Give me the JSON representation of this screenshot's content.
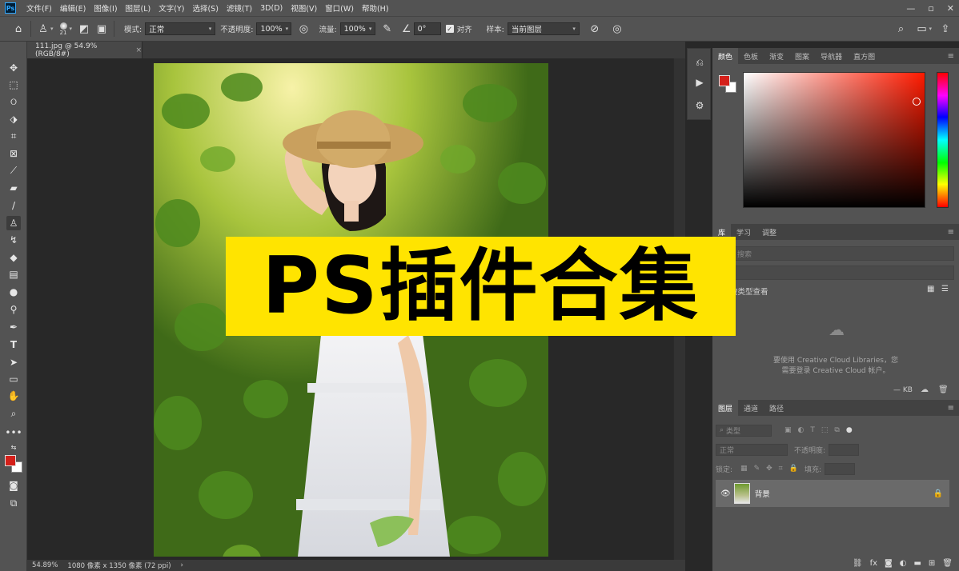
{
  "menubar": {
    "logo": "Ps",
    "items": [
      "文件(F)",
      "编辑(E)",
      "图像(I)",
      "图层(L)",
      "文字(Y)",
      "选择(S)",
      "滤镜(T)",
      "3D(D)",
      "视图(V)",
      "窗口(W)",
      "帮助(H)"
    ],
    "controls": [
      "—",
      "▫",
      "✕"
    ]
  },
  "options": {
    "brush_size": "21",
    "mode_label": "模式:",
    "mode_value": "正常",
    "opacity_label": "不透明度:",
    "opacity_value": "100%",
    "flow_label": "流量:",
    "flow_value": "100%",
    "angle_value": "0°",
    "align_label": "对齐",
    "sample_label": "样本:",
    "sample_value": "当前图层"
  },
  "document": {
    "tab_label": "111.jpg @ 54.9%(RGB/8#)",
    "tab_close": "×",
    "zoom": "54.89%",
    "dims": "1080 像素 x 1350 像素 (72 ppi)",
    "status_arrow": "›"
  },
  "banner": {
    "text": "PS插件合集",
    "color": "#ffe400"
  },
  "color_panel": {
    "tabs": [
      "颜色",
      "色板",
      "渐变",
      "图案",
      "导航器",
      "直方图"
    ],
    "foreground": "#d4201a",
    "background": "#ffffff"
  },
  "library_panel": {
    "tabs": [
      "库",
      "学习",
      "调整"
    ],
    "search_placeholder": "搜索",
    "view_label": "按类型查看",
    "message_line1": "要使用 Creative Cloud Libraries，您",
    "message_line2": "需要登录 Creative Cloud 帐户。",
    "size": "— KB"
  },
  "layers_panel": {
    "tabs": [
      "图层",
      "通道",
      "路径"
    ],
    "filter_placeholder": "类型",
    "blend_mode": "正常",
    "opacity_label": "不透明度:",
    "lock_label": "锁定:",
    "fill_label": "填充:",
    "layer_name": "背景"
  }
}
